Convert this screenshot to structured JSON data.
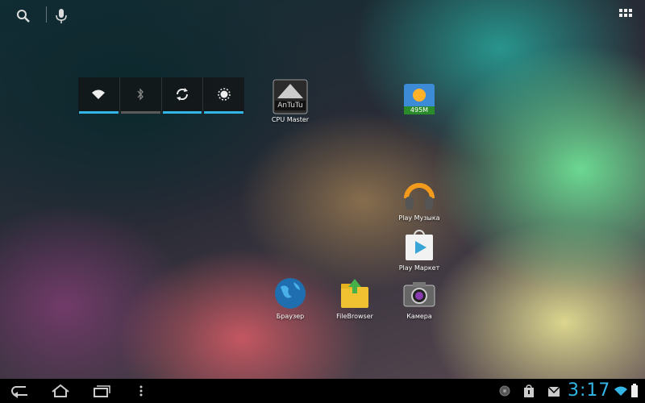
{
  "top_bar": {
    "search_icon": "search-icon",
    "voice_icon": "microphone-icon",
    "apps_icon": "all-apps-grid-icon"
  },
  "power_widget": {
    "toggles": [
      {
        "name": "wifi",
        "icon": "wifi-icon",
        "state": "on"
      },
      {
        "name": "bluetooth",
        "icon": "bluetooth-icon",
        "state": "off"
      },
      {
        "name": "sync",
        "icon": "sync-icon",
        "state": "on"
      },
      {
        "name": "brightness",
        "icon": "brightness-icon",
        "state": "on"
      }
    ]
  },
  "shortcuts": {
    "cpu_master": {
      "label": "CPU Master",
      "badge": "AnTuTu"
    },
    "weather": {
      "label": "",
      "badge": "495M"
    },
    "play_music": {
      "label": "Play Музыка"
    },
    "play_market": {
      "label": "Play Маркет"
    },
    "browser": {
      "label": "Браузер"
    },
    "filebrowser": {
      "label": "FileBrowser"
    },
    "camera": {
      "label": "Камера"
    }
  },
  "system_bar": {
    "clock": "3:17",
    "accent": "#33b5e5"
  }
}
